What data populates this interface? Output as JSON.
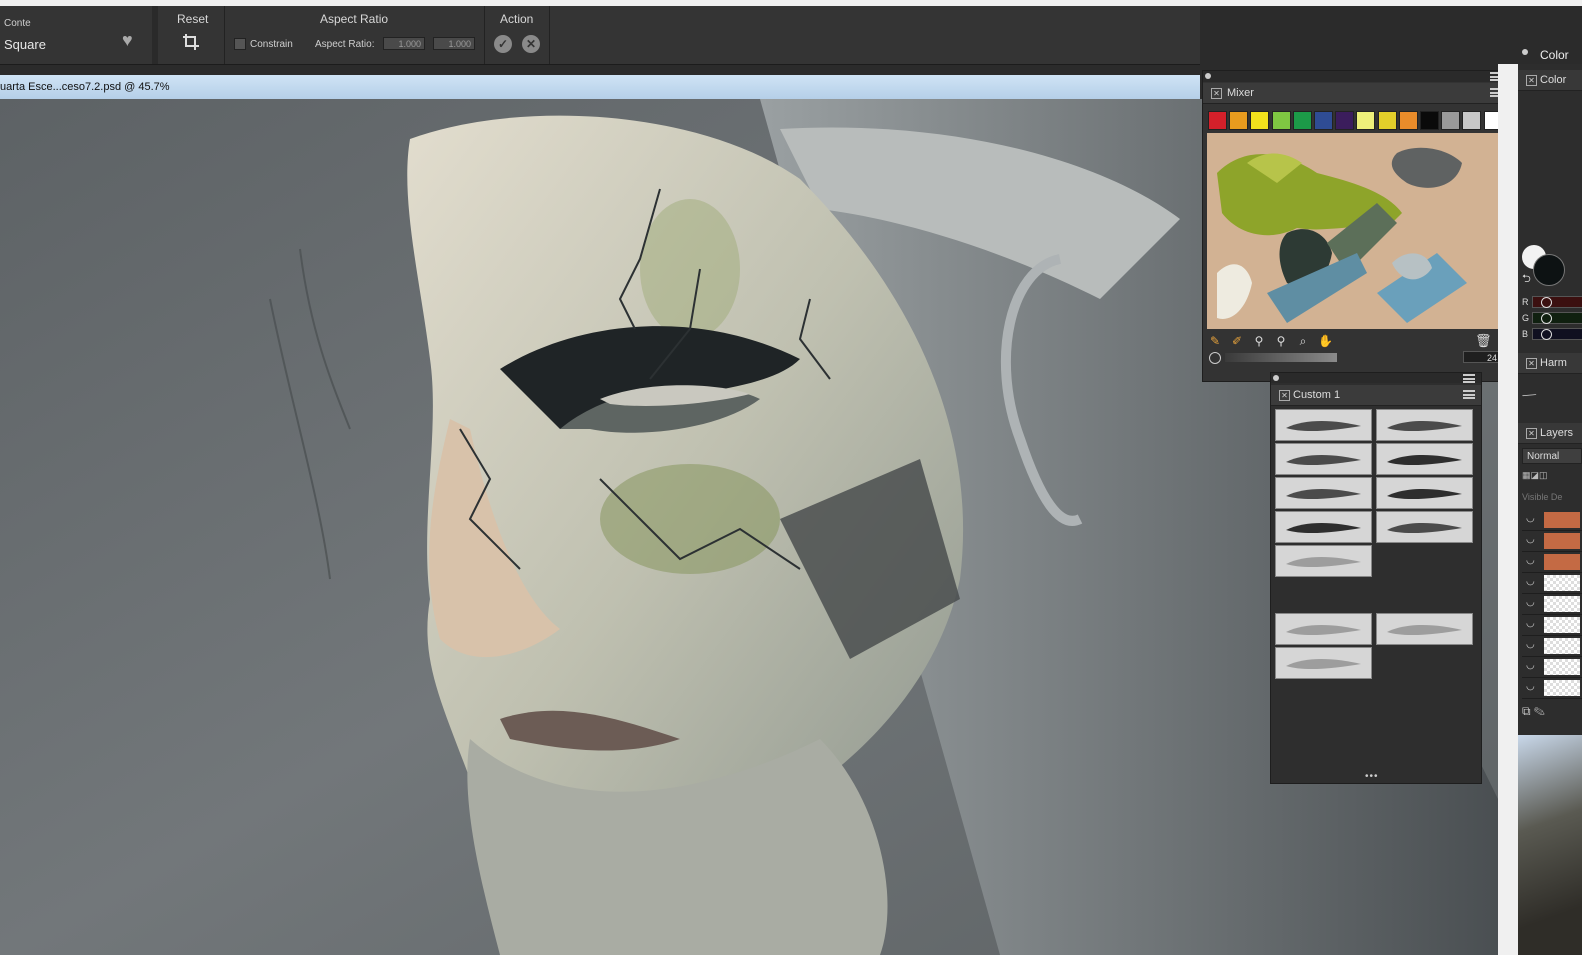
{
  "property_bar": {
    "brush_category": "Conte",
    "brush_variant": "Square",
    "reset_label": "Reset",
    "aspect_ratio_title": "Aspect Ratio",
    "constrain_label": "Constrain",
    "aspect_ratio_label": "Aspect Ratio:",
    "aspect_value_1": "1.000",
    "aspect_value_2": "1.000",
    "action_title": "Action"
  },
  "document": {
    "title": "uarta Esce...ceso7.2.psd @ 45.7%"
  },
  "mixer": {
    "title": "Mixer",
    "swatches": [
      "#d4202a",
      "#e89b1e",
      "#f2e21c",
      "#7fc742",
      "#1c9a48",
      "#2f4c94",
      "#3b1d5c",
      "#eef07a",
      "#e3cf2a",
      "#ea8c2a",
      "#0a0a0a",
      "#9a9a9a",
      "#c8c8c8",
      "#ffffff"
    ],
    "brush_size": "24",
    "tool_icons": [
      "dirty-brush-icon",
      "apply-color-icon",
      "sample-color-icon",
      "sample-multiple-icon",
      "zoom-icon",
      "pan-icon"
    ]
  },
  "custom_palette": {
    "title": "Custom 1"
  },
  "right_panels": {
    "color_top": "Color",
    "color": "Color",
    "r_label": "R",
    "g_label": "G",
    "b_label": "B",
    "harmony": "Harm",
    "layers": "Layers",
    "blend_mode": "Normal",
    "visible_label": "Visible De"
  }
}
